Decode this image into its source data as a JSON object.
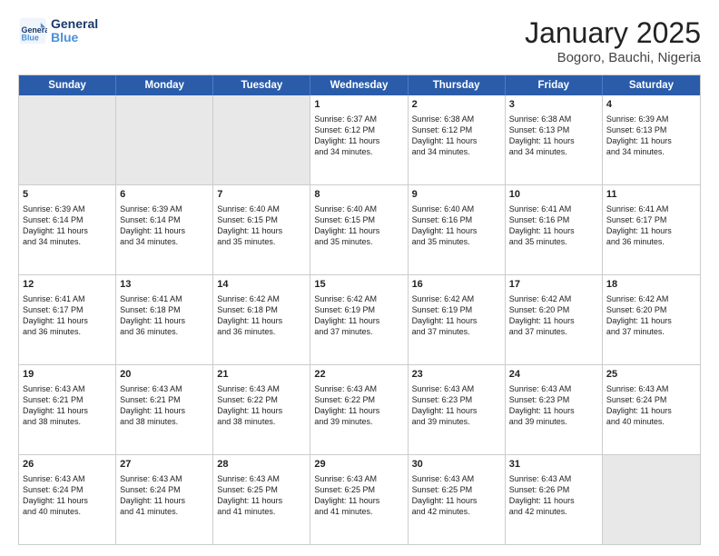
{
  "header": {
    "logo_line1": "General",
    "logo_line2": "Blue",
    "title": "January 2025",
    "subtitle": "Bogoro, Bauchi, Nigeria"
  },
  "weekdays": [
    "Sunday",
    "Monday",
    "Tuesday",
    "Wednesday",
    "Thursday",
    "Friday",
    "Saturday"
  ],
  "rows": [
    [
      {
        "day": "",
        "info": "",
        "shaded": true
      },
      {
        "day": "",
        "info": "",
        "shaded": true
      },
      {
        "day": "",
        "info": "",
        "shaded": true
      },
      {
        "day": "1",
        "info": "Sunrise: 6:37 AM\nSunset: 6:12 PM\nDaylight: 11 hours\nand 34 minutes.",
        "shaded": false
      },
      {
        "day": "2",
        "info": "Sunrise: 6:38 AM\nSunset: 6:12 PM\nDaylight: 11 hours\nand 34 minutes.",
        "shaded": false
      },
      {
        "day": "3",
        "info": "Sunrise: 6:38 AM\nSunset: 6:13 PM\nDaylight: 11 hours\nand 34 minutes.",
        "shaded": false
      },
      {
        "day": "4",
        "info": "Sunrise: 6:39 AM\nSunset: 6:13 PM\nDaylight: 11 hours\nand 34 minutes.",
        "shaded": false
      }
    ],
    [
      {
        "day": "5",
        "info": "Sunrise: 6:39 AM\nSunset: 6:14 PM\nDaylight: 11 hours\nand 34 minutes.",
        "shaded": false
      },
      {
        "day": "6",
        "info": "Sunrise: 6:39 AM\nSunset: 6:14 PM\nDaylight: 11 hours\nand 34 minutes.",
        "shaded": false
      },
      {
        "day": "7",
        "info": "Sunrise: 6:40 AM\nSunset: 6:15 PM\nDaylight: 11 hours\nand 35 minutes.",
        "shaded": false
      },
      {
        "day": "8",
        "info": "Sunrise: 6:40 AM\nSunset: 6:15 PM\nDaylight: 11 hours\nand 35 minutes.",
        "shaded": false
      },
      {
        "day": "9",
        "info": "Sunrise: 6:40 AM\nSunset: 6:16 PM\nDaylight: 11 hours\nand 35 minutes.",
        "shaded": false
      },
      {
        "day": "10",
        "info": "Sunrise: 6:41 AM\nSunset: 6:16 PM\nDaylight: 11 hours\nand 35 minutes.",
        "shaded": false
      },
      {
        "day": "11",
        "info": "Sunrise: 6:41 AM\nSunset: 6:17 PM\nDaylight: 11 hours\nand 36 minutes.",
        "shaded": false
      }
    ],
    [
      {
        "day": "12",
        "info": "Sunrise: 6:41 AM\nSunset: 6:17 PM\nDaylight: 11 hours\nand 36 minutes.",
        "shaded": false
      },
      {
        "day": "13",
        "info": "Sunrise: 6:41 AM\nSunset: 6:18 PM\nDaylight: 11 hours\nand 36 minutes.",
        "shaded": false
      },
      {
        "day": "14",
        "info": "Sunrise: 6:42 AM\nSunset: 6:18 PM\nDaylight: 11 hours\nand 36 minutes.",
        "shaded": false
      },
      {
        "day": "15",
        "info": "Sunrise: 6:42 AM\nSunset: 6:19 PM\nDaylight: 11 hours\nand 37 minutes.",
        "shaded": false
      },
      {
        "day": "16",
        "info": "Sunrise: 6:42 AM\nSunset: 6:19 PM\nDaylight: 11 hours\nand 37 minutes.",
        "shaded": false
      },
      {
        "day": "17",
        "info": "Sunrise: 6:42 AM\nSunset: 6:20 PM\nDaylight: 11 hours\nand 37 minutes.",
        "shaded": false
      },
      {
        "day": "18",
        "info": "Sunrise: 6:42 AM\nSunset: 6:20 PM\nDaylight: 11 hours\nand 37 minutes.",
        "shaded": false
      }
    ],
    [
      {
        "day": "19",
        "info": "Sunrise: 6:43 AM\nSunset: 6:21 PM\nDaylight: 11 hours\nand 38 minutes.",
        "shaded": false
      },
      {
        "day": "20",
        "info": "Sunrise: 6:43 AM\nSunset: 6:21 PM\nDaylight: 11 hours\nand 38 minutes.",
        "shaded": false
      },
      {
        "day": "21",
        "info": "Sunrise: 6:43 AM\nSunset: 6:22 PM\nDaylight: 11 hours\nand 38 minutes.",
        "shaded": false
      },
      {
        "day": "22",
        "info": "Sunrise: 6:43 AM\nSunset: 6:22 PM\nDaylight: 11 hours\nand 39 minutes.",
        "shaded": false
      },
      {
        "day": "23",
        "info": "Sunrise: 6:43 AM\nSunset: 6:23 PM\nDaylight: 11 hours\nand 39 minutes.",
        "shaded": false
      },
      {
        "day": "24",
        "info": "Sunrise: 6:43 AM\nSunset: 6:23 PM\nDaylight: 11 hours\nand 39 minutes.",
        "shaded": false
      },
      {
        "day": "25",
        "info": "Sunrise: 6:43 AM\nSunset: 6:24 PM\nDaylight: 11 hours\nand 40 minutes.",
        "shaded": false
      }
    ],
    [
      {
        "day": "26",
        "info": "Sunrise: 6:43 AM\nSunset: 6:24 PM\nDaylight: 11 hours\nand 40 minutes.",
        "shaded": false
      },
      {
        "day": "27",
        "info": "Sunrise: 6:43 AM\nSunset: 6:24 PM\nDaylight: 11 hours\nand 41 minutes.",
        "shaded": false
      },
      {
        "day": "28",
        "info": "Sunrise: 6:43 AM\nSunset: 6:25 PM\nDaylight: 11 hours\nand 41 minutes.",
        "shaded": false
      },
      {
        "day": "29",
        "info": "Sunrise: 6:43 AM\nSunset: 6:25 PM\nDaylight: 11 hours\nand 41 minutes.",
        "shaded": false
      },
      {
        "day": "30",
        "info": "Sunrise: 6:43 AM\nSunset: 6:25 PM\nDaylight: 11 hours\nand 42 minutes.",
        "shaded": false
      },
      {
        "day": "31",
        "info": "Sunrise: 6:43 AM\nSunset: 6:26 PM\nDaylight: 11 hours\nand 42 minutes.",
        "shaded": false
      },
      {
        "day": "",
        "info": "",
        "shaded": true
      }
    ]
  ]
}
